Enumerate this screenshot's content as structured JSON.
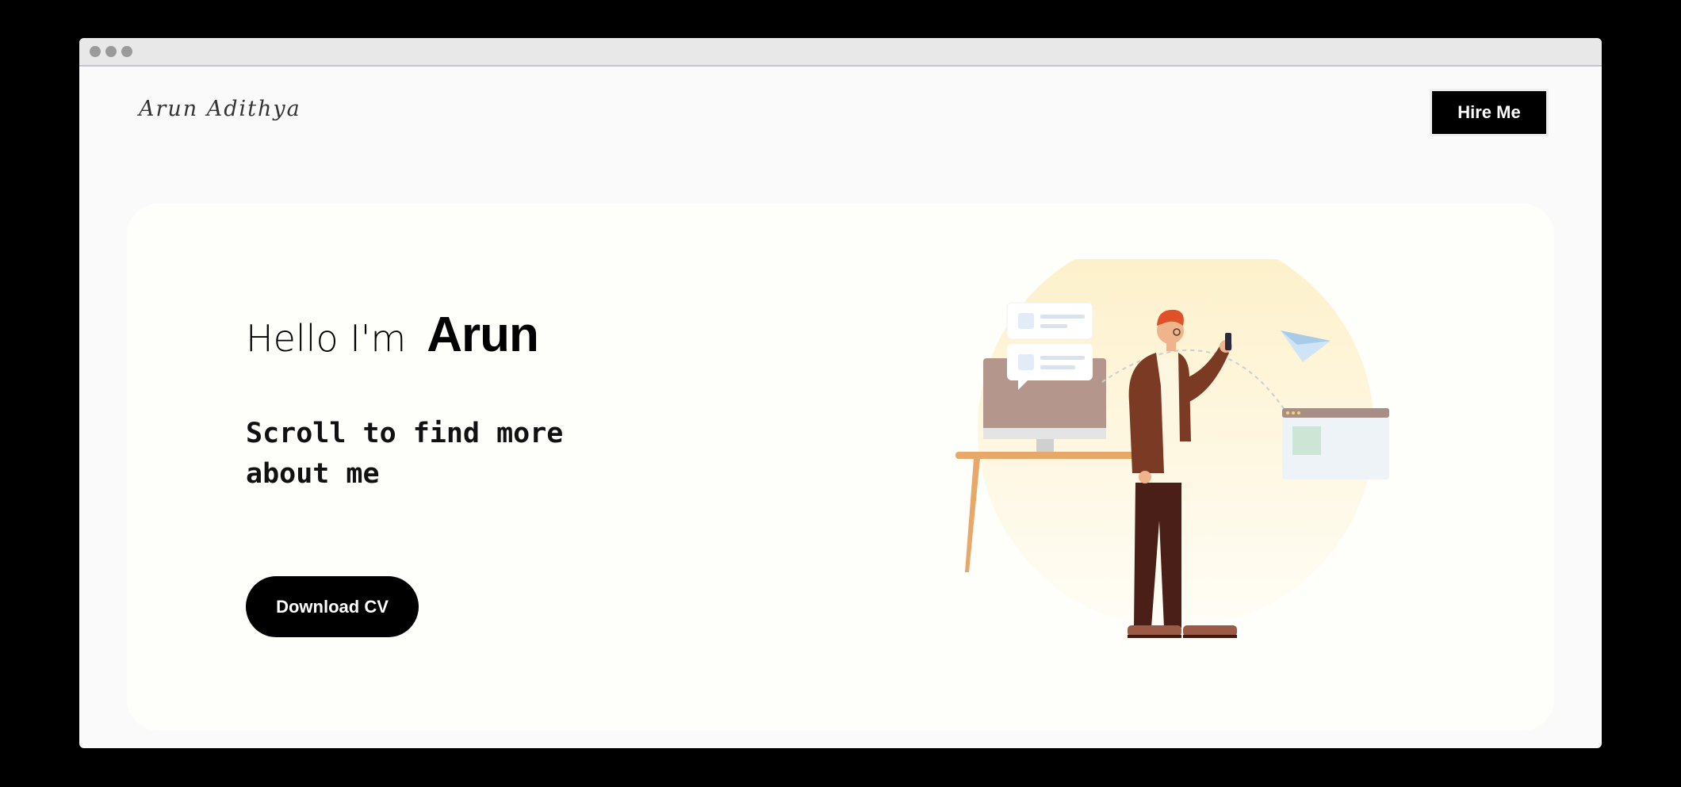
{
  "header": {
    "logo_text": "Arun Adithya",
    "hire_label": "Hire Me"
  },
  "hero": {
    "greeting": "Hello I'm",
    "name": "Arun",
    "tagline": "Scroll to find more about me",
    "cv_label": "Download CV"
  },
  "colors": {
    "accent": "#000000",
    "background": "#fafafa",
    "hero_bg": "#fefefb",
    "sun_circle": "#fdf1cf"
  },
  "icons": {
    "window_controls": "traffic-light-dots",
    "illustration": "person-with-phone-at-desk"
  }
}
